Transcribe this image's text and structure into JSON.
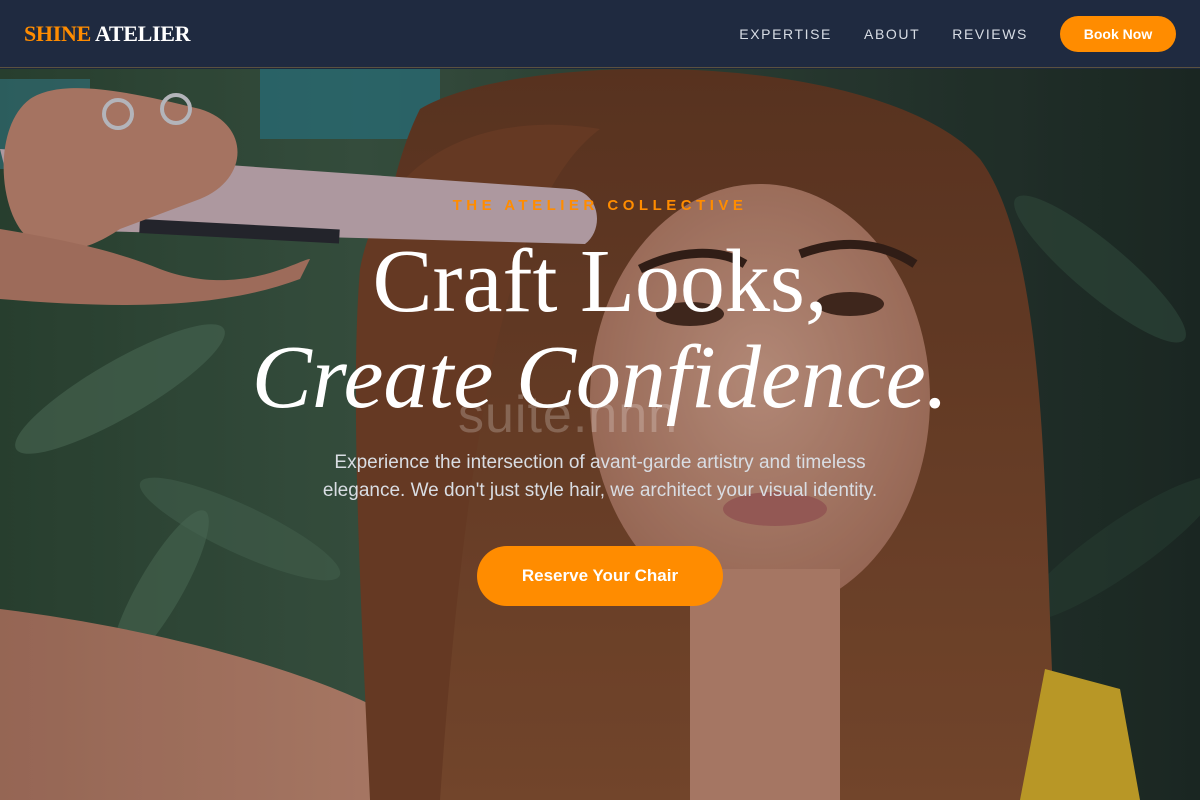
{
  "nav": {
    "logo_part1": "SHINE",
    "logo_part2": " ATELIER",
    "links": [
      "EXPERTISE",
      "ABOUT",
      "REVIEWS"
    ],
    "cta": "Book Now"
  },
  "hero": {
    "eyebrow": "THE ATELIER COLLECTIVE",
    "headline_line1": "Craft Looks,",
    "headline_line2": "Create Confidence.",
    "subtext_line1": "Experience the intersection of avant-garde artistry and timeless",
    "subtext_line2": "elegance. We don't just style hair, we architect your visual identity.",
    "cta": "Reserve Your Chair",
    "watermark": "suite.nnn"
  },
  "colors": {
    "accent": "#ff8c00",
    "nav_bg": "#1f2a40",
    "text_light": "#ffffff"
  }
}
